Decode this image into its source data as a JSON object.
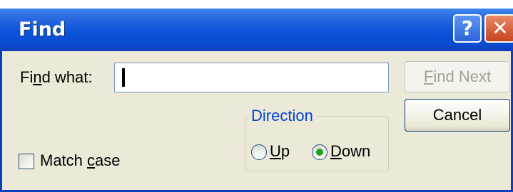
{
  "window": {
    "title": "Find"
  },
  "titlebar": {
    "help_glyph": "?",
    "close_glyph": "✕",
    "help_icon": "help-icon",
    "close_icon": "close-icon"
  },
  "find": {
    "label_prefix": "Fi",
    "label_underlined": "n",
    "label_suffix": "d what:",
    "value": ""
  },
  "buttons": {
    "find_next_underlined": "F",
    "find_next_rest": "ind Next",
    "cancel": "Cancel"
  },
  "direction": {
    "legend": "Direction",
    "up_underlined": "U",
    "up_rest": "p",
    "down_underlined": "D",
    "down_rest": "own",
    "selected": "Down"
  },
  "match_case": {
    "label_prefix": "Match ",
    "label_underlined": "c",
    "label_suffix": "ase",
    "checked": false
  },
  "colors": {
    "title_bar": "#0b53d6",
    "dialog_bg": "#ece9d8",
    "legend_text": "#0046d5",
    "radio_dot": "#21a121"
  }
}
